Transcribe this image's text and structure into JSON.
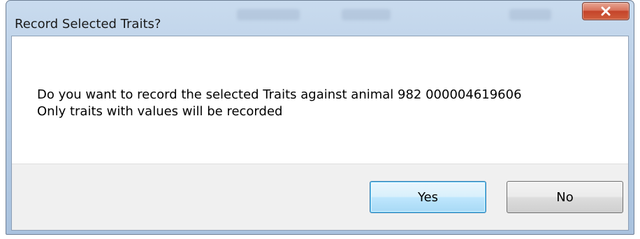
{
  "window": {
    "title": "Record Selected Traits?",
    "close_icon": "close-icon"
  },
  "message": {
    "line1": "Do you want to record the selected Traits against animal 982 000004619606",
    "line2": "Only traits with values will be recorded"
  },
  "buttons": {
    "yes_label": "Yes",
    "no_label": "No",
    "default": "Yes"
  },
  "colors": {
    "close_button": "#c5442a",
    "default_button_border": "#3c7fb1",
    "button_bar": "#f0f0f0"
  }
}
